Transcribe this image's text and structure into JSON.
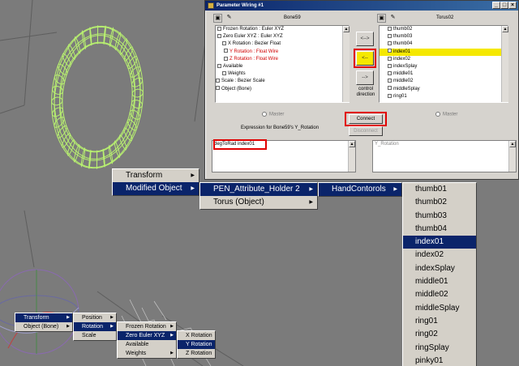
{
  "dialog": {
    "title": "Parameter Wiring #1",
    "left_panel": {
      "node_name": "Bone59",
      "tree_items": [
        {
          "label": "Frozen Rotation : Euler XYZ",
          "style": "normal"
        },
        {
          "label": "Zero Euler XYZ : Euler XYZ",
          "style": "normal"
        },
        {
          "label": "X Rotation : Bezier Float",
          "style": "normal"
        },
        {
          "label": "Y Rotation : Float Wire",
          "style": "red"
        },
        {
          "label": "Z Rotation : Float Wire",
          "style": "red"
        },
        {
          "label": "Available",
          "style": "normal"
        },
        {
          "label": "Weights",
          "style": "normal"
        },
        {
          "label": "Scale : Bezier Scale",
          "style": "normal"
        },
        {
          "label": "Object (Bone)",
          "style": "normal"
        }
      ],
      "master_label": "Master",
      "expression_caption": "Expression for Bone59's Y_Rotation",
      "expression_value": "degToRad index01"
    },
    "right_panel": {
      "node_name": "Torus02",
      "tree_items": [
        {
          "label": "thumb02",
          "style": "normal"
        },
        {
          "label": "thumb03",
          "style": "normal"
        },
        {
          "label": "thumb04",
          "style": "normal"
        },
        {
          "label": "index01",
          "style": "sel"
        },
        {
          "label": "index02",
          "style": "normal"
        },
        {
          "label": "indexSplay",
          "style": "normal"
        },
        {
          "label": "middle01",
          "style": "normal"
        },
        {
          "label": "middle02",
          "style": "normal"
        },
        {
          "label": "middleSplay",
          "style": "normal"
        },
        {
          "label": "ring01",
          "style": "normal"
        }
      ],
      "master_label": "Master",
      "expression_value": "Y_Rotation"
    },
    "arrows": {
      "top": "<-->",
      "middle": "<--",
      "bottom": "-->"
    },
    "control_direction_label": "control\ndirection",
    "connect_label": "Connect",
    "disconnect_label": "Disconnect"
  },
  "menus": {
    "large_main": [
      {
        "label": "Transform",
        "has_sub": true,
        "selected": false
      },
      {
        "label": "Modified Object",
        "has_sub": true,
        "selected": true
      }
    ],
    "large_sub1": [
      {
        "label": "PEN_Attribute_Holder 2",
        "has_sub": true,
        "selected": true
      },
      {
        "label": "Torus (Object)",
        "has_sub": true,
        "selected": false
      }
    ],
    "large_sub2": [
      {
        "label": "HandContorols",
        "has_sub": true,
        "selected": true
      }
    ],
    "large_list": [
      {
        "label": "thumb01",
        "selected": false
      },
      {
        "label": "thumb02",
        "selected": false
      },
      {
        "label": "thumb03",
        "selected": false
      },
      {
        "label": "thumb04",
        "selected": false
      },
      {
        "label": "index01",
        "selected": true
      },
      {
        "label": "index02",
        "selected": false
      },
      {
        "label": "indexSplay",
        "selected": false
      },
      {
        "label": "middle01",
        "selected": false
      },
      {
        "label": "middle02",
        "selected": false
      },
      {
        "label": "middleSplay",
        "selected": false
      },
      {
        "label": "ring01",
        "selected": false
      },
      {
        "label": "ring02",
        "selected": false
      },
      {
        "label": "ringSplay",
        "selected": false
      },
      {
        "label": "pinky01",
        "selected": false
      }
    ],
    "small_main": [
      {
        "label": "Transform",
        "has_sub": true,
        "selected": true
      },
      {
        "label": "Object (Bone)",
        "has_sub": true,
        "selected": false
      }
    ],
    "small_sub1": [
      {
        "label": "Position",
        "has_sub": true,
        "selected": false
      },
      {
        "label": "Rotation",
        "has_sub": true,
        "selected": true
      },
      {
        "label": "Scale",
        "has_sub": false,
        "selected": false
      }
    ],
    "small_sub2": [
      {
        "label": "Frozen Rotation",
        "has_sub": true,
        "selected": false
      },
      {
        "label": "Zero Euler XYZ",
        "has_sub": true,
        "selected": true
      },
      {
        "label": "Available",
        "has_sub": false,
        "selected": false
      },
      {
        "label": "Weights",
        "has_sub": true,
        "selected": false
      }
    ],
    "small_sub3": [
      {
        "label": "X Rotation",
        "has_sub": false,
        "selected": false
      },
      {
        "label": "Y Rotation",
        "has_sub": false,
        "selected": true
      },
      {
        "label": "Z Rotation",
        "has_sub": false,
        "selected": false
      }
    ]
  },
  "colors": {
    "viewport": "#7b7b7b",
    "menu_highlight": "#0a246a",
    "annotation_red": "#e00000",
    "wire_red": "#d00000",
    "list_highlight": "#f5e800",
    "torus_wire": "#b8f070"
  },
  "icons": [
    "window-icon",
    "pick-node-icon",
    "tree-checkbox-icon",
    "submenu-arrow-icon",
    "scroll-arrow-icon"
  ]
}
